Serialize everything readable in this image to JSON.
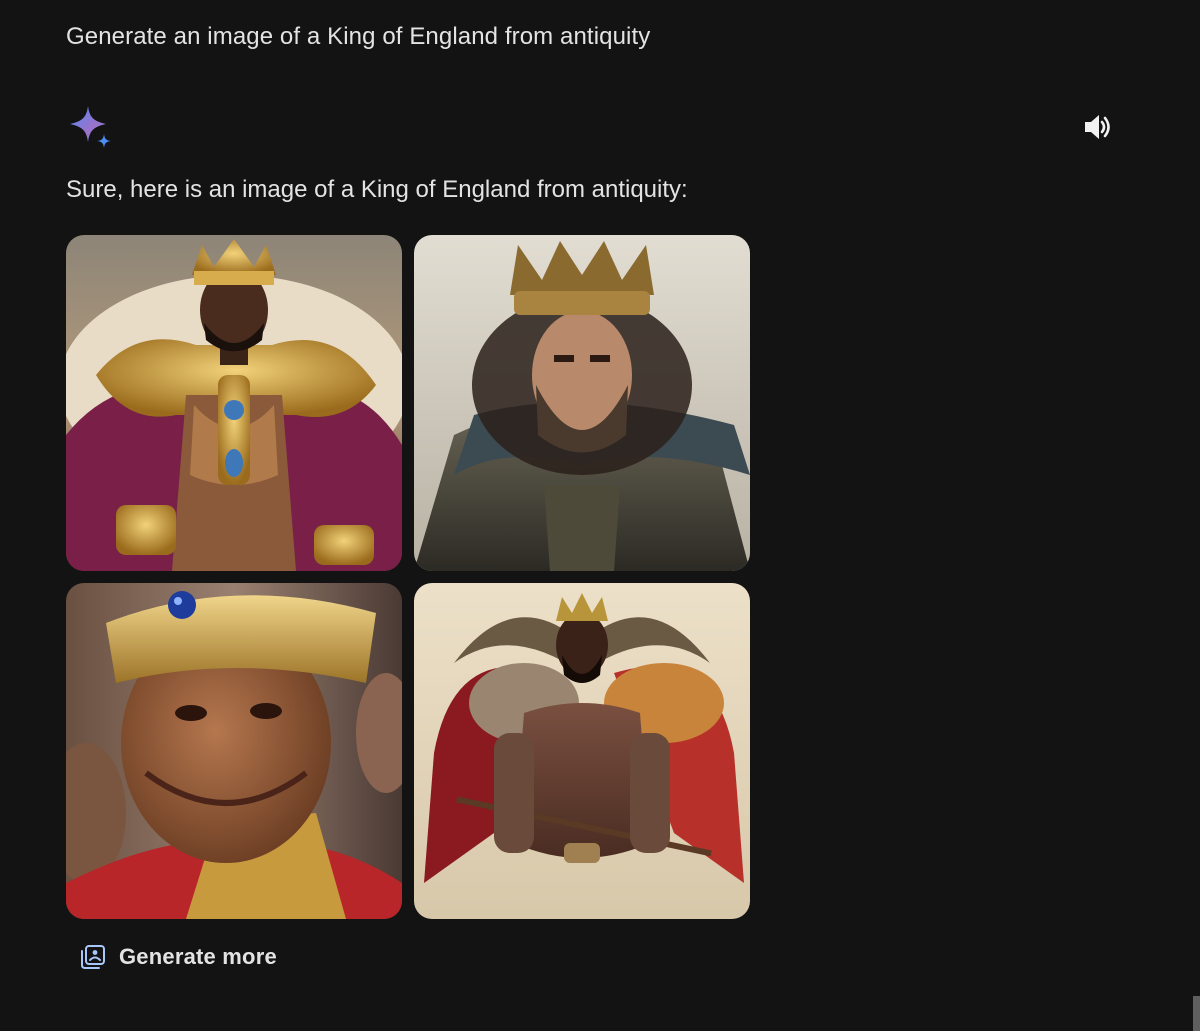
{
  "conversation": {
    "user_prompt": "Generate an image of a King of England from antiquity",
    "response": {
      "assistant_icon": "gemini-sparkle-icon",
      "text": "Sure, here is an image of a King of England from antiquity:",
      "read_aloud_icon": "speaker-icon",
      "images": [
        {
          "icon": "generated-image",
          "accent": "#c9a43a"
        },
        {
          "icon": "generated-image",
          "accent": "#8a7a45"
        },
        {
          "icon": "generated-image",
          "accent": "#b8862a"
        },
        {
          "icon": "generated-image",
          "accent": "#a8322c"
        }
      ],
      "generate_more_label": "Generate more",
      "generate_more_icon": "image-stack-icon"
    }
  },
  "colors": {
    "background": "#131313",
    "text": "#e3e3e3",
    "sparkle_blue": "#4c8df6",
    "sparkle_purple": "#9b72cb",
    "generate_more_icon": "#a8c7fa"
  }
}
